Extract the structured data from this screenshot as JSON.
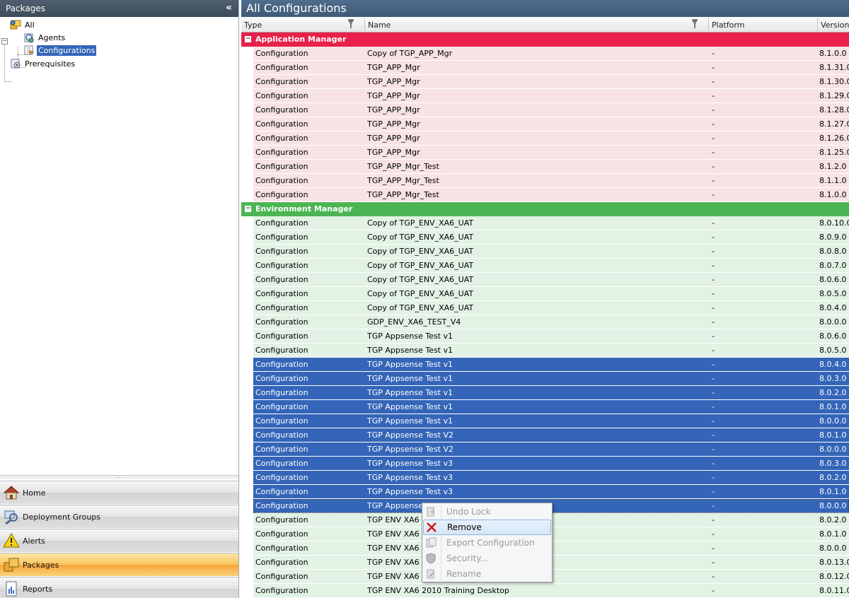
{
  "left": {
    "title": "Packages",
    "collapse_glyph": "«",
    "tree": [
      {
        "label": "All",
        "icon": "packages-icon",
        "level": 0
      },
      {
        "label": "Agents",
        "icon": "agent-icon",
        "level": 1
      },
      {
        "label": "Configurations",
        "icon": "configuration-icon",
        "level": 1,
        "selected": true
      },
      {
        "label": "Prerequisites",
        "icon": "prerequisite-icon",
        "level": 0
      }
    ],
    "tree_toggle": "−",
    "grip": "....",
    "nav": [
      {
        "label": "Home",
        "icon": "home-icon"
      },
      {
        "label": "Deployment Groups",
        "icon": "deployment-groups-icon"
      },
      {
        "label": "Alerts",
        "icon": "alert-icon"
      },
      {
        "label": "Packages",
        "icon": "packages-icon",
        "active": true
      },
      {
        "label": "Reports",
        "icon": "reports-icon"
      }
    ]
  },
  "main": {
    "title": "All Configurations",
    "columns": [
      "Type",
      "Name",
      "Platform",
      "Version"
    ],
    "groups": [
      {
        "name": "Application Manager",
        "color": "#e8204a",
        "toggle": "−",
        "rows": [
          [
            "Configuration",
            "Copy of TGP_APP_Mgr",
            "-",
            "8.1.0.0"
          ],
          [
            "Configuration",
            "TGP_APP_Mgr",
            "-",
            "8.1.31.0"
          ],
          [
            "Configuration",
            "TGP_APP_Mgr",
            "-",
            "8.1.30.0"
          ],
          [
            "Configuration",
            "TGP_APP_Mgr",
            "-",
            "8.1.29.0"
          ],
          [
            "Configuration",
            "TGP_APP_Mgr",
            "-",
            "8.1.28.0"
          ],
          [
            "Configuration",
            "TGP_APP_Mgr",
            "-",
            "8.1.27.0"
          ],
          [
            "Configuration",
            "TGP_APP_Mgr",
            "-",
            "8.1.26.0"
          ],
          [
            "Configuration",
            "TGP_APP_Mgr",
            "-",
            "8.1.25.0"
          ],
          [
            "Configuration",
            "TGP_APP_Mgr_Test",
            "-",
            "8.1.2.0"
          ],
          [
            "Configuration",
            "TGP_APP_Mgr_Test",
            "-",
            "8.1.1.0"
          ],
          [
            "Configuration",
            "TGP_APP_Mgr_Test",
            "-",
            "8.1.0.0"
          ]
        ]
      },
      {
        "name": "Environment Manager",
        "color": "#4cb553",
        "toggle": "−",
        "rows": [
          [
            "Configuration",
            "Copy of TGP_ENV_XA6_UAT",
            "-",
            "8.0.10.0"
          ],
          [
            "Configuration",
            "Copy of TGP_ENV_XA6_UAT",
            "-",
            "8.0.9.0"
          ],
          [
            "Configuration",
            "Copy of TGP_ENV_XA6_UAT",
            "-",
            "8.0.8.0"
          ],
          [
            "Configuration",
            "Copy of TGP_ENV_XA6_UAT",
            "-",
            "8.0.7.0"
          ],
          [
            "Configuration",
            "Copy of TGP_ENV_XA6_UAT",
            "-",
            "8.0.6.0"
          ],
          [
            "Configuration",
            "Copy of TGP_ENV_XA6_UAT",
            "-",
            "8.0.5.0"
          ],
          [
            "Configuration",
            "Copy of TGP_ENV_XA6_UAT",
            "-",
            "8.0.4.0"
          ],
          [
            "Configuration",
            "GDP_ENV_XA6_TEST_V4",
            "-",
            "8.0.0.0"
          ],
          [
            "Configuration",
            "TGP Appsense Test v1",
            "-",
            "8.0.6.0"
          ],
          [
            "Configuration",
            "TGP Appsense Test v1",
            "-",
            "8.0.5.0"
          ],
          [
            "Configuration",
            "TGP Appsense Test v1",
            "-",
            "8.0.4.0",
            "sel"
          ],
          [
            "Configuration",
            "TGP Appsense Test v1",
            "-",
            "8.0.3.0",
            "sel"
          ],
          [
            "Configuration",
            "TGP Appsense Test v1",
            "-",
            "8.0.2.0",
            "sel"
          ],
          [
            "Configuration",
            "TGP Appsense Test v1",
            "-",
            "8.0.1.0",
            "sel"
          ],
          [
            "Configuration",
            "TGP Appsense Test v1",
            "-",
            "8.0.0.0",
            "sel"
          ],
          [
            "Configuration",
            "TGP Appsense Test V2",
            "-",
            "8.0.1.0",
            "sel"
          ],
          [
            "Configuration",
            "TGP Appsense Test V2",
            "-",
            "8.0.0.0",
            "sel"
          ],
          [
            "Configuration",
            "TGP Appsense Test v3",
            "-",
            "8.0.3.0",
            "sel"
          ],
          [
            "Configuration",
            "TGP Appsense Test v3",
            "-",
            "8.0.2.0",
            "sel"
          ],
          [
            "Configuration",
            "TGP Appsense Test v3",
            "-",
            "8.0.1.0",
            "sel"
          ],
          [
            "Configuration",
            "TGP Appsense T",
            "-",
            "8.0.0.0",
            "sel focus"
          ],
          [
            "Configuration",
            "TGP ENV XA6 20",
            "-",
            "8.0.2.0"
          ],
          [
            "Configuration",
            "TGP ENV XA6 20",
            "-",
            "8.0.1.0"
          ],
          [
            "Configuration",
            "TGP ENV XA6 20",
            "-",
            "8.0.0.0"
          ],
          [
            "Configuration",
            "TGP ENV XA6 20",
            "-",
            "8.0.13.0"
          ],
          [
            "Configuration",
            "TGP ENV XA6 20",
            "-",
            "8.0.12.0"
          ],
          [
            "Configuration",
            "TGP ENV XA6 2010 Training Desktop",
            "-",
            "8.0.11.0"
          ]
        ]
      }
    ]
  },
  "context_menu": {
    "items": [
      {
        "label": "Undo Lock",
        "icon": "undo-lock-icon",
        "disabled": true
      },
      {
        "label": "Remove",
        "icon": "remove-icon",
        "disabled": false,
        "hover": true
      },
      {
        "label": "Export Configuration",
        "icon": "export-icon",
        "disabled": true
      },
      {
        "label": "Security...",
        "icon": "security-shield-icon",
        "disabled": true
      },
      {
        "label": "Rename",
        "icon": "rename-icon",
        "disabled": true
      }
    ]
  }
}
